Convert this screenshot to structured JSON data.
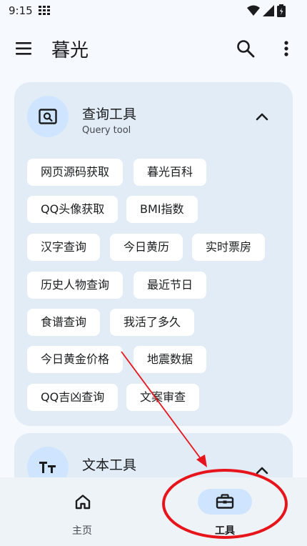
{
  "status": {
    "time": "9:15"
  },
  "appbar": {
    "title": "暮光"
  },
  "query_card": {
    "title": "查询工具",
    "subtitle": "Query tool",
    "chips": [
      "网页源码获取",
      "暮光百科",
      "QQ头像获取",
      "BMI指数",
      "汉字查询",
      "今日黄历",
      "实时票房",
      "历史人物查询",
      "最近节日",
      "食谱查询",
      "我活了多久",
      "今日黄金价格",
      "地震数据",
      "QQ吉凶查询",
      "文案审查"
    ]
  },
  "text_card": {
    "title": "文本工具"
  },
  "bottom_nav": [
    {
      "label": "主页",
      "icon": "home-icon"
    },
    {
      "label": "工具",
      "icon": "toolbox-icon",
      "selected": true
    }
  ],
  "colors": {
    "accent": "#cfe5ff",
    "card": "#e1ecf6",
    "annotation": "#e8141c"
  }
}
